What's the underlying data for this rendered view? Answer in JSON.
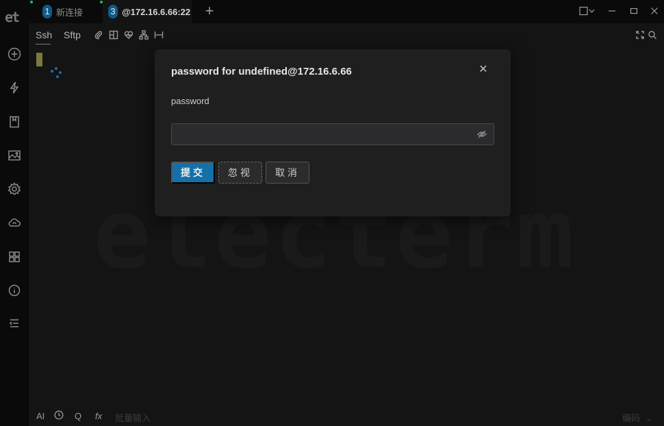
{
  "app": {
    "logo_text": "et",
    "colors": {
      "accent": "#1470a8",
      "tab_badge": "#0e5a8a",
      "status_dot": "#1bbf6a"
    }
  },
  "tabs": [
    {
      "number": "1",
      "label": "新连接",
      "active": false
    },
    {
      "number": "3",
      "label": "@172.16.6.66:22",
      "active": true
    }
  ],
  "tabbar": {
    "add_icon": "plus-icon"
  },
  "window_controls": [
    "layout-icon",
    "minimize-icon",
    "maximize-icon",
    "close-icon"
  ],
  "sidebar": {
    "icons": [
      "add-circle-icon",
      "lightning-icon",
      "bookmark-icon",
      "image-icon",
      "settings-icon",
      "cloud-sync-icon",
      "widgets-icon",
      "info-icon",
      "menu-list-icon"
    ]
  },
  "subbar": {
    "tabs": [
      "Ssh",
      "Sftp"
    ],
    "tool_icons": [
      "attachment-icon",
      "split-icon",
      "heart-icon",
      "network-icon",
      "width-icon"
    ],
    "right_icons": [
      "fullscreen-icon",
      "search-icon"
    ]
  },
  "terminal": {
    "watermark": "electerm"
  },
  "bottombar": {
    "ai_label": "AI",
    "history_icon": "clock-icon",
    "q_label": "Q",
    "fx_label": "fx",
    "batch_placeholder": "批量输入",
    "encoding_label": "编码"
  },
  "modal": {
    "title": "password for undefined@172.16.6.66",
    "field_label": "password",
    "password_value": "",
    "submit_label": "提交",
    "ignore_label": "忽视",
    "cancel_label": "取消"
  }
}
